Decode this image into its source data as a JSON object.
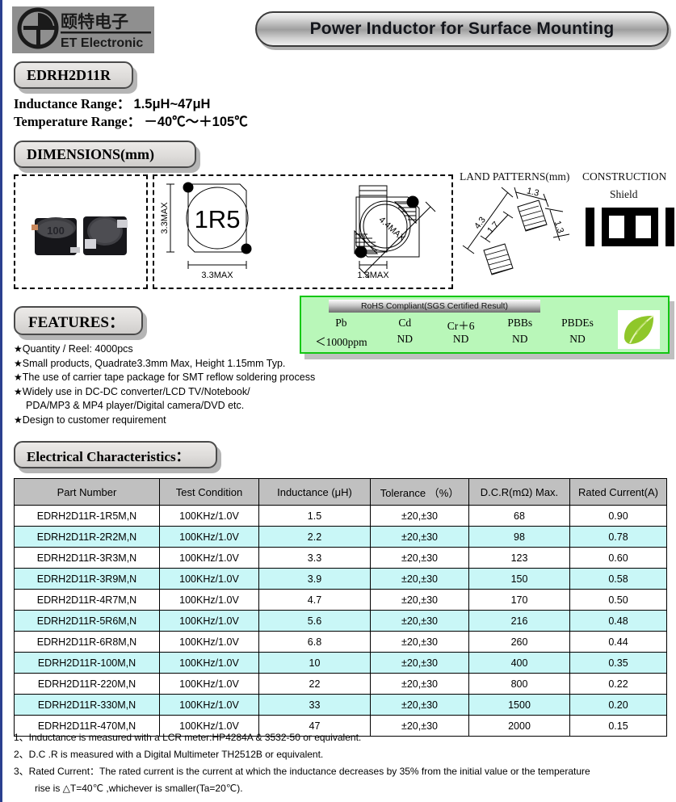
{
  "header": {
    "logo_cn": "颐特电子",
    "logo_en": "ET Electronic",
    "logo_name": "et-electronic-logo",
    "title": "Power Inductor for Surface Mounting"
  },
  "part": {
    "series_label": "EDRH2D11R",
    "inductance_range_label": "Inductance Range：",
    "inductance_range_value": "1.5μH~47μH",
    "temperature_range_label": "Temperature Range：",
    "temperature_range_value": "－40℃～＋105℃"
  },
  "dimensions": {
    "section_label": "DIMENSIONS(mm)",
    "top_view_marking": "1R5",
    "height_dim": "3.3MAX",
    "width_dim": "3.3MAX",
    "side_dim": "1.3MAX",
    "diagonal_dim": "4.4MAX",
    "land_patterns_label": "LAND PATTERNS(mm)",
    "land_dims": {
      "pad_pitch": "4.3",
      "inner_gap": "1.7",
      "pad_width": "1.3",
      "pad_height": "1.3"
    },
    "construction_label": "CONSTRUCTION",
    "construction_type": "Shield"
  },
  "rohs": {
    "bar_text": "RoHS Compliant(SGS Certified Result)",
    "substances": [
      "Pb",
      "Cd",
      "Cr＋6",
      "PBBs",
      "PBDEs"
    ],
    "results": [
      "＜1000ppm",
      "ND",
      "ND",
      "ND",
      "ND"
    ],
    "leaf_icon": "green-leaf-icon",
    "border_color": "#12c712",
    "fill_color": "#b9f7b9"
  },
  "features": {
    "section_label": "FEATURES：",
    "bullet": "★",
    "items": [
      "Quantity / Reel: 4000pcs",
      "Small products, Quadrate3.3mm Max, Height 1.15mm Typ.",
      "The use of carrier tape package for SMT reflow soldering process",
      "Widely use in DC-DC converter/LCD TV/Notebook/",
      "Design to customer requirement"
    ],
    "continuation": "PDA/MP3 & MP4 player/Digital camera/DVD etc."
  },
  "electrical": {
    "section_label": "Electrical Characteristics：",
    "columns": [
      "Part Number",
      "Test Condition",
      "Inductance  (μH)",
      "Tolerance （%）",
      "D.C.R(mΩ) Max.",
      "Rated Current(A)"
    ],
    "rows": [
      [
        "EDRH2D11R-1R5M,N",
        "100KHz/1.0V",
        "1.5",
        "±20,±30",
        "68",
        "0.90"
      ],
      [
        "EDRH2D11R-2R2M,N",
        "100KHz/1.0V",
        "2.2",
        "±20,±30",
        "98",
        "0.78"
      ],
      [
        "EDRH2D11R-3R3M,N",
        "100KHz/1.0V",
        "3.3",
        "±20,±30",
        "123",
        "0.60"
      ],
      [
        "EDRH2D11R-3R9M,N",
        "100KHz/1.0V",
        "3.9",
        "±20,±30",
        "150",
        "0.58"
      ],
      [
        "EDRH2D11R-4R7M,N",
        "100KHz/1.0V",
        "4.7",
        "±20,±30",
        "170",
        "0.50"
      ],
      [
        "EDRH2D11R-5R6M,N",
        "100KHz/1.0V",
        "5.6",
        "±20,±30",
        "216",
        "0.48"
      ],
      [
        "EDRH2D11R-6R8M,N",
        "100KHz/1.0V",
        "6.8",
        "±20,±30",
        "260",
        "0.44"
      ],
      [
        "EDRH2D11R-100M,N",
        "100KHz/1.0V",
        "10",
        "±20,±30",
        "400",
        "0.35"
      ],
      [
        "EDRH2D11R-220M,N",
        "100KHz/1.0V",
        "22",
        "±20,±30",
        "800",
        "0.22"
      ],
      [
        "EDRH2D11R-330M,N",
        "100KHz/1.0V",
        "33",
        "±20,±30",
        "1500",
        "0.20"
      ],
      [
        "EDRH2D11R-470M,N",
        "100KHz/1.0V",
        "47",
        "±20,±30",
        "2000",
        "0.15"
      ]
    ],
    "header_bg": "#c0c0c0",
    "alt_row_bg": "#c9f7f7"
  },
  "notes": [
    "1、Inductance is measured with a LCR meter:HP4284A & 3532-50 or equivalent.",
    "2、D.C .R is measured with a Digital Multimeter TH2512B or equivalent.",
    "3、Rated Current：The rated current is the current at which the inductance decreases by 35% from the initial value or the temperature"
  ],
  "note_continuation": "rise is △T=40℃ ,whichever is smaller(Ta=20℃)."
}
